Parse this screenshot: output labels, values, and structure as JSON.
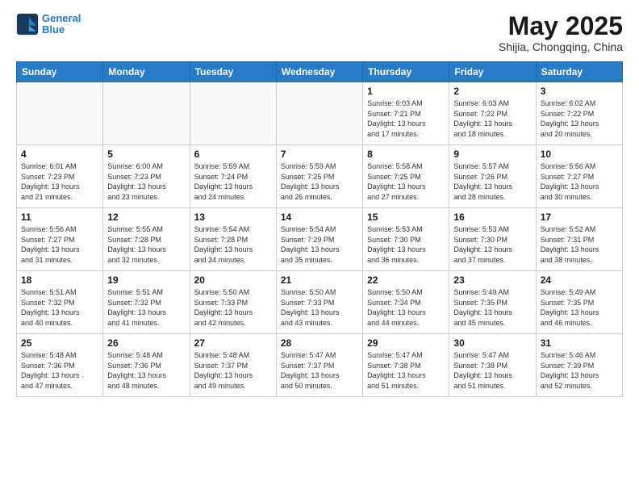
{
  "header": {
    "logo_line1": "General",
    "logo_line2": "Blue",
    "month": "May 2025",
    "location": "Shijia, Chongqing, China"
  },
  "weekdays": [
    "Sunday",
    "Monday",
    "Tuesday",
    "Wednesday",
    "Thursday",
    "Friday",
    "Saturday"
  ],
  "weeks": [
    [
      {
        "day": "",
        "info": ""
      },
      {
        "day": "",
        "info": ""
      },
      {
        "day": "",
        "info": ""
      },
      {
        "day": "",
        "info": ""
      },
      {
        "day": "1",
        "info": "Sunrise: 6:03 AM\nSunset: 7:21 PM\nDaylight: 13 hours\nand 17 minutes."
      },
      {
        "day": "2",
        "info": "Sunrise: 6:03 AM\nSunset: 7:22 PM\nDaylight: 13 hours\nand 18 minutes."
      },
      {
        "day": "3",
        "info": "Sunrise: 6:02 AM\nSunset: 7:22 PM\nDaylight: 13 hours\nand 20 minutes."
      }
    ],
    [
      {
        "day": "4",
        "info": "Sunrise: 6:01 AM\nSunset: 7:23 PM\nDaylight: 13 hours\nand 21 minutes."
      },
      {
        "day": "5",
        "info": "Sunrise: 6:00 AM\nSunset: 7:23 PM\nDaylight: 13 hours\nand 23 minutes."
      },
      {
        "day": "6",
        "info": "Sunrise: 5:59 AM\nSunset: 7:24 PM\nDaylight: 13 hours\nand 24 minutes."
      },
      {
        "day": "7",
        "info": "Sunrise: 5:59 AM\nSunset: 7:25 PM\nDaylight: 13 hours\nand 26 minutes."
      },
      {
        "day": "8",
        "info": "Sunrise: 5:58 AM\nSunset: 7:25 PM\nDaylight: 13 hours\nand 27 minutes."
      },
      {
        "day": "9",
        "info": "Sunrise: 5:57 AM\nSunset: 7:26 PM\nDaylight: 13 hours\nand 28 minutes."
      },
      {
        "day": "10",
        "info": "Sunrise: 5:56 AM\nSunset: 7:27 PM\nDaylight: 13 hours\nand 30 minutes."
      }
    ],
    [
      {
        "day": "11",
        "info": "Sunrise: 5:56 AM\nSunset: 7:27 PM\nDaylight: 13 hours\nand 31 minutes."
      },
      {
        "day": "12",
        "info": "Sunrise: 5:55 AM\nSunset: 7:28 PM\nDaylight: 13 hours\nand 32 minutes."
      },
      {
        "day": "13",
        "info": "Sunrise: 5:54 AM\nSunset: 7:28 PM\nDaylight: 13 hours\nand 34 minutes."
      },
      {
        "day": "14",
        "info": "Sunrise: 5:54 AM\nSunset: 7:29 PM\nDaylight: 13 hours\nand 35 minutes."
      },
      {
        "day": "15",
        "info": "Sunrise: 5:53 AM\nSunset: 7:30 PM\nDaylight: 13 hours\nand 36 minutes."
      },
      {
        "day": "16",
        "info": "Sunrise: 5:53 AM\nSunset: 7:30 PM\nDaylight: 13 hours\nand 37 minutes."
      },
      {
        "day": "17",
        "info": "Sunrise: 5:52 AM\nSunset: 7:31 PM\nDaylight: 13 hours\nand 38 minutes."
      }
    ],
    [
      {
        "day": "18",
        "info": "Sunrise: 5:51 AM\nSunset: 7:32 PM\nDaylight: 13 hours\nand 40 minutes."
      },
      {
        "day": "19",
        "info": "Sunrise: 5:51 AM\nSunset: 7:32 PM\nDaylight: 13 hours\nand 41 minutes."
      },
      {
        "day": "20",
        "info": "Sunrise: 5:50 AM\nSunset: 7:33 PM\nDaylight: 13 hours\nand 42 minutes."
      },
      {
        "day": "21",
        "info": "Sunrise: 5:50 AM\nSunset: 7:33 PM\nDaylight: 13 hours\nand 43 minutes."
      },
      {
        "day": "22",
        "info": "Sunrise: 5:50 AM\nSunset: 7:34 PM\nDaylight: 13 hours\nand 44 minutes."
      },
      {
        "day": "23",
        "info": "Sunrise: 5:49 AM\nSunset: 7:35 PM\nDaylight: 13 hours\nand 45 minutes."
      },
      {
        "day": "24",
        "info": "Sunrise: 5:49 AM\nSunset: 7:35 PM\nDaylight: 13 hours\nand 46 minutes."
      }
    ],
    [
      {
        "day": "25",
        "info": "Sunrise: 5:48 AM\nSunset: 7:36 PM\nDaylight: 13 hours\nand 47 minutes."
      },
      {
        "day": "26",
        "info": "Sunrise: 5:48 AM\nSunset: 7:36 PM\nDaylight: 13 hours\nand 48 minutes."
      },
      {
        "day": "27",
        "info": "Sunrise: 5:48 AM\nSunset: 7:37 PM\nDaylight: 13 hours\nand 49 minutes."
      },
      {
        "day": "28",
        "info": "Sunrise: 5:47 AM\nSunset: 7:37 PM\nDaylight: 13 hours\nand 50 minutes."
      },
      {
        "day": "29",
        "info": "Sunrise: 5:47 AM\nSunset: 7:38 PM\nDaylight: 13 hours\nand 51 minutes."
      },
      {
        "day": "30",
        "info": "Sunrise: 5:47 AM\nSunset: 7:38 PM\nDaylight: 13 hours\nand 51 minutes."
      },
      {
        "day": "31",
        "info": "Sunrise: 5:46 AM\nSunset: 7:39 PM\nDaylight: 13 hours\nand 52 minutes."
      }
    ]
  ]
}
